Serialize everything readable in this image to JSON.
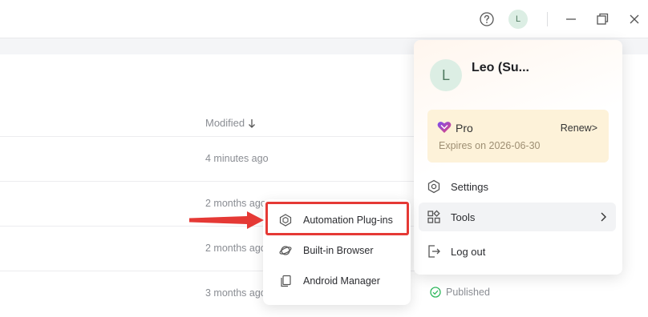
{
  "window": {
    "user_initial": "L",
    "icons": [
      "help-icon",
      "minimize-icon",
      "restore-icon",
      "close-icon"
    ]
  },
  "file_list": {
    "column_header": "Modified",
    "rows": [
      {
        "modified": "4 minutes ago"
      },
      {
        "modified": "2 months ago"
      },
      {
        "modified": "2 months ago"
      },
      {
        "modified": "3 months ago"
      }
    ],
    "status_label": "Published"
  },
  "profile_menu": {
    "avatar_initial": "L",
    "user_name": "Leo (Su...",
    "plan": {
      "name": "Pro",
      "renew_label": "Renew>",
      "expires": "Expires on 2026-06-30"
    },
    "items": [
      {
        "label": "Settings",
        "icon": "gear-icon"
      },
      {
        "label": "Tools",
        "icon": "grid-icon"
      },
      {
        "label": "Log out",
        "icon": "logout-icon"
      }
    ]
  },
  "tools_submenu": {
    "items": [
      {
        "label": "Automation Plug-ins",
        "icon": "plugin-icon"
      },
      {
        "label": "Built-in Browser",
        "icon": "browser-icon"
      },
      {
        "label": "Android Manager",
        "icon": "android-manager-icon"
      }
    ]
  },
  "colors": {
    "accent": "#4f7a60",
    "highlight": "#e53935",
    "pro_background": "#fdf2d9",
    "published": "#2eb85c"
  }
}
